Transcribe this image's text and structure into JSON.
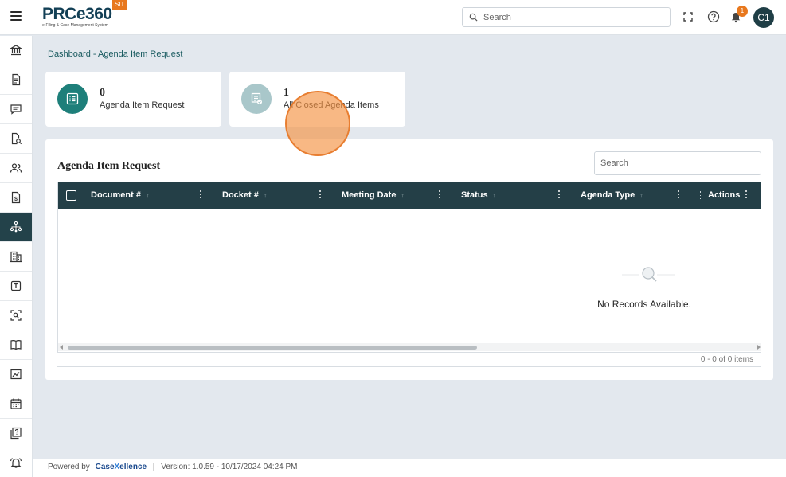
{
  "app": {
    "logo_text": "PRCe360",
    "logo_subtitle": "e-Filing & Case Management System",
    "env_badge": "SIT"
  },
  "topbar": {
    "search_placeholder": "Search",
    "notification_count": "1",
    "avatar_initials": "C1"
  },
  "sidebar": {
    "items": [
      {
        "icon": "bank-icon",
        "active": false
      },
      {
        "icon": "document-icon",
        "active": false
      },
      {
        "icon": "chat-icon",
        "active": false
      },
      {
        "icon": "document-search-icon",
        "active": false
      },
      {
        "icon": "users-icon",
        "active": false
      },
      {
        "icon": "invoice-icon",
        "active": false
      },
      {
        "icon": "hierarchy-icon",
        "active": true
      },
      {
        "icon": "building-icon",
        "active": false
      },
      {
        "icon": "text-box-icon",
        "active": false
      },
      {
        "icon": "scan-search-icon",
        "active": false
      },
      {
        "icon": "book-icon",
        "active": false
      },
      {
        "icon": "chart-icon",
        "active": false
      },
      {
        "icon": "calendar-icon",
        "active": false
      },
      {
        "icon": "help-docs-icon",
        "active": false
      },
      {
        "icon": "bell-alert-icon",
        "active": false
      }
    ]
  },
  "breadcrumb": "Dashboard - Agenda Item Request",
  "cards": [
    {
      "count": "0",
      "label": "Agenda Item Request",
      "icon": "list-icon",
      "color": "#1e7f7a"
    },
    {
      "count": "1",
      "label": "All Closed Agenda Items",
      "icon": "checklist-icon",
      "color": "#a9c7ca"
    }
  ],
  "panel": {
    "title": "Agenda Item Request",
    "search_placeholder": "Search",
    "columns": [
      "Document #",
      "Docket #",
      "Meeting Date",
      "Status",
      "Agenda Type",
      "Actions"
    ],
    "empty_message": "No Records Available.",
    "pager_text": "0 - 0 of 0 items"
  },
  "footer": {
    "powered_by": "Powered by",
    "brand_case": "Case",
    "brand_x": "X",
    "brand_rest": "ellence",
    "separator": "|",
    "version": "Version: 1.0.59 - 10/17/2024 04:24 PM"
  },
  "colors": {
    "primary_dark": "#243f47",
    "accent_teal": "#1e7f7a",
    "accent_orange": "#e8781e"
  }
}
